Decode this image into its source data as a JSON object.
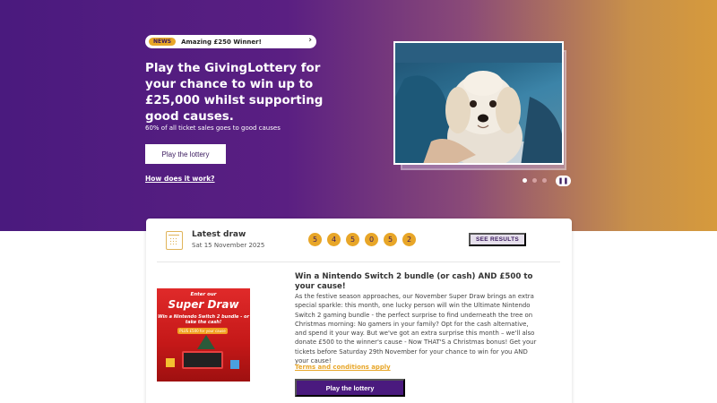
{
  "hero": {
    "news_tag": "NEWS",
    "news_text": "Amazing £250 Winner!",
    "title": "Play the GivingLottery for your chance to win up to £25,000 whilst supporting good causes.",
    "subtitle": "60% of all ticket sales goes to good causes",
    "cta_label": "Play the lottery",
    "how_link": "How does it work?",
    "pause_label": "❚❚"
  },
  "latest_draw": {
    "label": "Latest draw",
    "date": "Sat 15 November 2025",
    "numbers": [
      "5",
      "4",
      "5",
      "0",
      "5",
      "2"
    ],
    "see_results_label": "SEE RESULTS"
  },
  "promo": {
    "image_text": {
      "enter": "Enter our",
      "super": "Super Draw",
      "win": "Win a Nintendo Switch 2 bundle - or take the cash!",
      "badge": "PLUS £500 for your cause"
    },
    "title": "Win a Nintendo Switch 2 bundle (or cash) AND £500 to your cause!",
    "body": "As the festive season approaches, our November Super Draw brings an extra special sparkle: this month, one lucky person will win the Ultimate Nintendo Switch 2 gaming bundle - the perfect surprise to find underneath the tree on Christmas morning: No gamers in your family? Opt for the cash alternative, and spend it your way. But we've got an extra surprise this month – we'll also donate £500 to the winner's cause - Now THAT'S a Christmas bonus! Get your tickets before Saturday 29th November for your chance to win for you AND your cause!",
    "terms_label": "Terms and conditions apply",
    "cta_label": "Play the lottery"
  },
  "colors": {
    "brand_purple": "#4a1a7e",
    "brand_gold": "#e8a628"
  }
}
